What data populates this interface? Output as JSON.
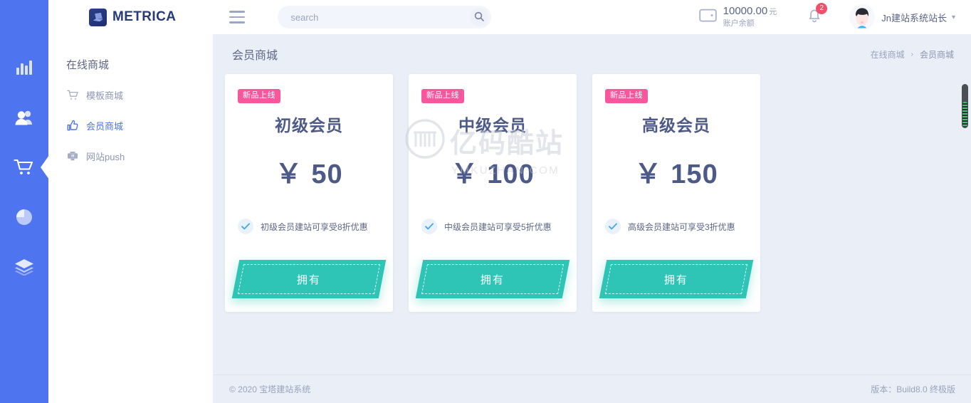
{
  "brand": {
    "name": "METRICA",
    "logo_icon": "laptop-icon",
    "color": "#283a78"
  },
  "topbar": {
    "menu_icon": "hamburger-icon",
    "search": {
      "placeholder": "search",
      "value": "",
      "icon": "search-icon"
    },
    "wallet": {
      "icon": "wallet-icon",
      "amount": "10000.00",
      "unit": "元",
      "label": "账户余额"
    },
    "notifications": {
      "icon": "bell-icon",
      "count": "2"
    },
    "user": {
      "avatar_icon": "avatar-icon",
      "name": "Jn建站系统站长",
      "caret_icon": "chevron-down-icon"
    }
  },
  "rail": {
    "accent": "#4e74f0",
    "items": [
      {
        "icon": "bar-chart-icon",
        "active": false
      },
      {
        "icon": "users-icon",
        "active": false
      },
      {
        "icon": "shopping-cart-icon",
        "active": true
      },
      {
        "icon": "pie-chart-icon",
        "active": false
      },
      {
        "icon": "layers-icon",
        "active": false
      }
    ]
  },
  "sidebar": {
    "title": "在线商城",
    "items": [
      {
        "icon": "cart-outline-icon",
        "label": "模板商城",
        "active": false
      },
      {
        "icon": "thumbs-up-icon",
        "label": "会员商城",
        "active": true
      },
      {
        "icon": "push-icon",
        "label": "网站push",
        "active": false
      }
    ]
  },
  "page": {
    "title": "会员商城",
    "breadcrumb": {
      "parent": "在线商城",
      "separator": "›",
      "current": "会员商城"
    }
  },
  "cards": [
    {
      "badge": "新品上线",
      "title": "初级会员",
      "currency": "￥",
      "price": "50",
      "feature_icon": "check-circle-icon",
      "feature": "初级会员建站可享受8折优惠",
      "button": "拥有"
    },
    {
      "badge": "新品上线",
      "title": "中级会员",
      "currency": "￥",
      "price": "100",
      "feature_icon": "check-circle-icon",
      "feature": "中级会员建站可享受5折优惠",
      "button": "拥有"
    },
    {
      "badge": "新品上线",
      "title": "高级会员",
      "currency": "￥",
      "price": "150",
      "feature_icon": "check-circle-icon",
      "feature": "高级会员建站可享受3折优惠",
      "button": "拥有"
    }
  ],
  "watermark": {
    "logo_icon": "ym-logo-icon",
    "text": "亿码酷站",
    "sub": "YMKUZHAN.COM"
  },
  "footer": {
    "left": "© 2020 宝塔建站系统",
    "right": "版本：Build8.0 终极版"
  },
  "colors": {
    "rail_blue": "#4e74f0",
    "content_bg": "#e9eef7",
    "badge_pink": "#f8579d",
    "button_teal": "#2ec5b6",
    "text_dark": "#4d5a87"
  }
}
